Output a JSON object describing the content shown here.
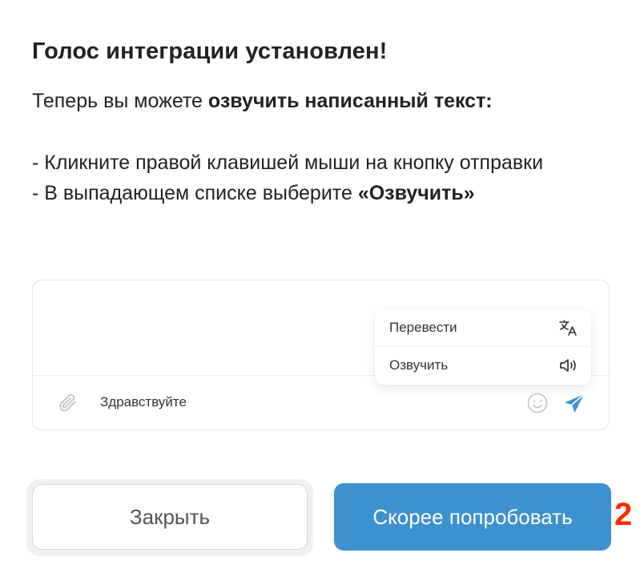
{
  "dialog": {
    "title": "Голос интеграции установлен!",
    "intro_prefix": "Теперь вы можете ",
    "intro_bold": "озвучить написанный текст:",
    "step1": "- Кликните правой клавишей мыши на кнопку отправки",
    "step2_prefix": "- В выпадающем списке выберите ",
    "step2_bold": "«Озвучить»"
  },
  "demo": {
    "message_text": "Здравствуйте",
    "menu_items": [
      {
        "label": "Перевести",
        "icon": "translate-icon"
      },
      {
        "label": "Озвучить",
        "icon": "speaker-icon"
      }
    ],
    "icons": [
      "paperclip-icon",
      "smile-icon",
      "send-icon"
    ],
    "accent_color": "#3d91cf"
  },
  "buttons": {
    "close_label": "Закрыть",
    "try_label": "Скорее попробовать"
  },
  "annotation": {
    "marker": "2",
    "marker_color": "#ff2a00"
  }
}
